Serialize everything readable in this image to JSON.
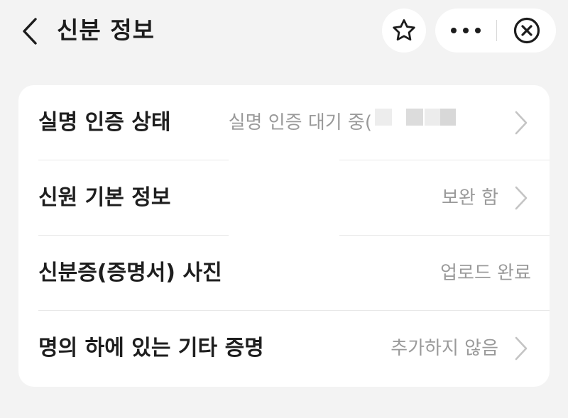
{
  "header": {
    "title": "신분 정보"
  },
  "rows": [
    {
      "label": "실명 인증 상태",
      "value": "실명 인증 대기 중("
    },
    {
      "label": "신원 기본 정보",
      "value": "보완 함"
    },
    {
      "label": "신분증(증명서) 사진",
      "value": "업로드 완료"
    },
    {
      "label": "명의 하에 있는 기타 증명",
      "value": "추가하지 않음"
    }
  ],
  "icons": {
    "back": "chevron-left-icon",
    "favorite": "star-icon",
    "more": "more-dots-icon",
    "close": "close-circle-icon",
    "row_arrow": "chevron-right-icon"
  },
  "colors": {
    "background": "#f3f3f3",
    "card": "#ffffff",
    "title_text": "#1c1c1c",
    "label_text": "#1e1e1e",
    "value_text": "#9a9a9a",
    "chevron": "#c4c4c4"
  }
}
